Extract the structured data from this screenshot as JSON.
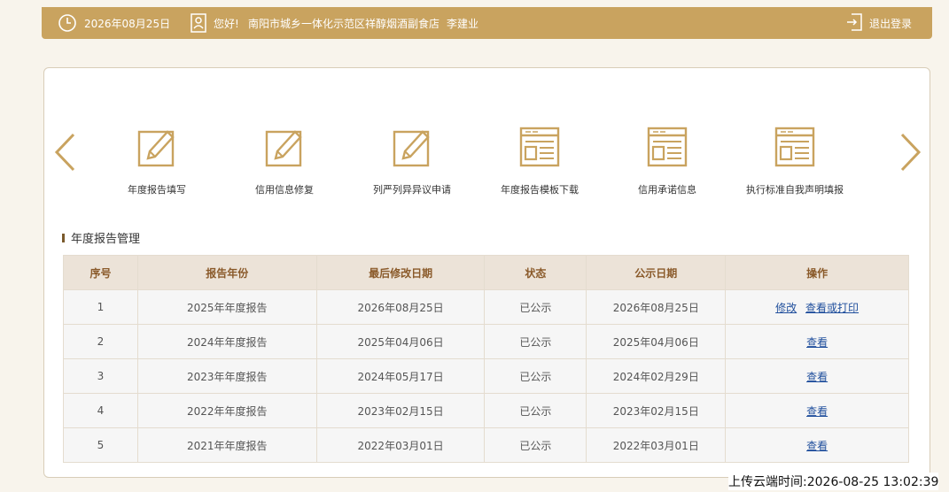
{
  "header": {
    "date": "2026年08月25日",
    "greeting": "您好!",
    "company": "南阳市城乡一体化示范区祥醇烟酒副食店",
    "user": "李建业",
    "logout": "退出登录"
  },
  "functions": [
    {
      "label": "年度报告填写",
      "icon": "edit-icon"
    },
    {
      "label": "信用信息修复",
      "icon": "edit-icon"
    },
    {
      "label": "列严列异异议申请",
      "icon": "edit-icon"
    },
    {
      "label": "年度报告模板下载",
      "icon": "document-icon"
    },
    {
      "label": "信用承诺信息",
      "icon": "document-icon"
    },
    {
      "label": "执行标准自我声明填报",
      "icon": "document-icon"
    }
  ],
  "section": {
    "title": "年度报告管理"
  },
  "table": {
    "headers": [
      "序号",
      "报告年份",
      "最后修改日期",
      "状态",
      "公示日期",
      "操作"
    ],
    "rows": [
      {
        "no": "1",
        "year": "2025年年度报告",
        "modified": "2026年08月25日",
        "status": "已公示",
        "published": "2026年08月25日",
        "actions": [
          "修改",
          "查看或打印"
        ]
      },
      {
        "no": "2",
        "year": "2024年年度报告",
        "modified": "2025年04月06日",
        "status": "已公示",
        "published": "2025年04月06日",
        "actions": [
          "查看"
        ]
      },
      {
        "no": "3",
        "year": "2023年年度报告",
        "modified": "2024年05月17日",
        "status": "已公示",
        "published": "2024年02月29日",
        "actions": [
          "查看"
        ]
      },
      {
        "no": "4",
        "year": "2022年年度报告",
        "modified": "2023年02月15日",
        "status": "已公示",
        "published": "2023年02月15日",
        "actions": [
          "查看"
        ]
      },
      {
        "no": "5",
        "year": "2021年年度报告",
        "modified": "2022年03月01日",
        "status": "已公示",
        "published": "2022年03月01日",
        "actions": [
          "查看"
        ]
      }
    ]
  },
  "footer": {
    "upload_time": "上传云端时间:2026-08-25 13:02:39"
  },
  "colors": {
    "accent": "#c9a35f",
    "header_bg": "#ece3d8",
    "link": "#1f4e9c"
  }
}
